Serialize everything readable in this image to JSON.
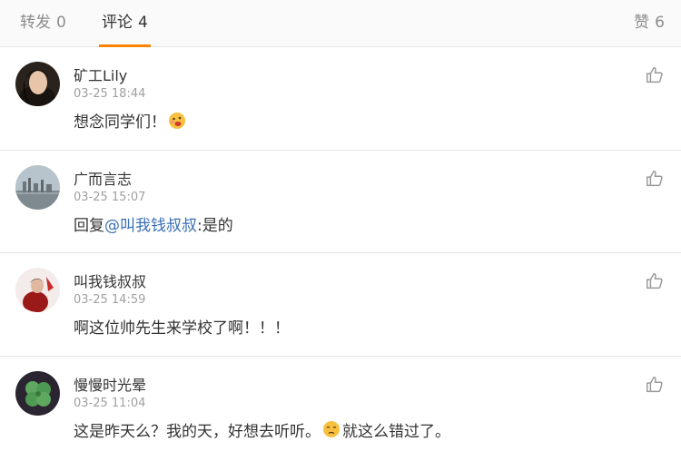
{
  "tabs": {
    "repost": {
      "label": "转发",
      "count": "0"
    },
    "comments": {
      "label": "评论",
      "count": "4"
    },
    "likes": {
      "label": "赞",
      "count": "6"
    }
  },
  "colors": {
    "accent": "#ff8200",
    "mention": "#3a6fb5"
  },
  "comments": [
    {
      "name": "矿工Lily",
      "time": "03-25 18:44",
      "text": "想念同学们！",
      "emoji": "drooling-face-emoji"
    },
    {
      "name": "广而言志",
      "time": "03-25 15:07",
      "reply_prefix": "回复",
      "mention": "@叫我钱叔叔",
      "text": ":是的"
    },
    {
      "name": "叫我钱叔叔",
      "time": "03-25 14:59",
      "text": "啊这位帅先生来学校了啊！！！"
    },
    {
      "name": "慢慢时光晕",
      "time": "03-25 11:04",
      "text_before": "这是昨天么？我的天，好想去听听。",
      "emoji": "sad-face-emoji",
      "text_after": "就这么错过了。"
    }
  ]
}
